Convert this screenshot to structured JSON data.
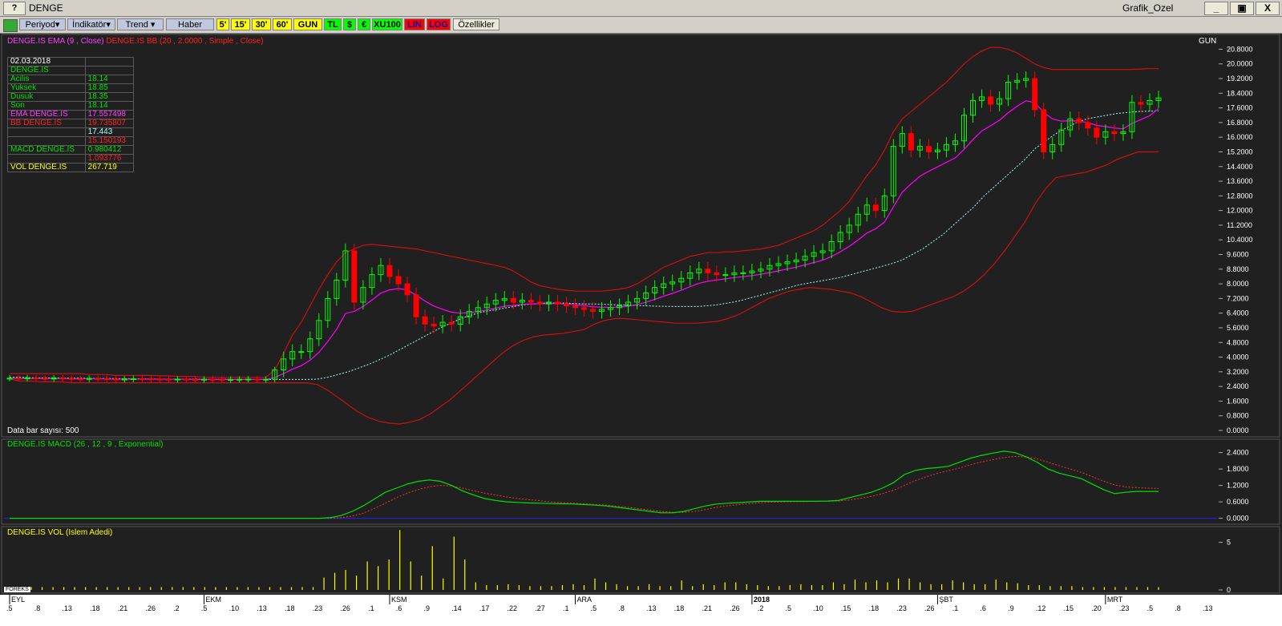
{
  "window": {
    "help": "?",
    "title": "DENGE",
    "right_title": "Grafik_Ozel",
    "min": "_",
    "restore": "▣",
    "close": "X"
  },
  "toolbar": {
    "periyod": "Periyod▾",
    "indikator": "İndikatör▾",
    "trend": "Trend ▾",
    "haber": "Haber",
    "p5": "5'",
    "p15": "15'",
    "p30": "30'",
    "p60": "60'",
    "gun": "GUN",
    "tl": "TL",
    "usd": "$",
    "eur": "€",
    "xu100": "XU100",
    "lin": "LIN",
    "log": "LOG",
    "ozellikler": "Özellikler"
  },
  "price_panel": {
    "legend_ema": "DENGE.IS EMA (9 , Close)",
    "legend_bb": "DENGE.IS BB (20 , 2.0000 , Simple , Close)",
    "period_label": "GUN",
    "bar_count": "Data bar sayısı: 500",
    "colors": {
      "up": "#00ff00",
      "down": "#ff0000",
      "ema": "#ff00ff",
      "bb": "#cc1010",
      "sma": "#a0ffff"
    }
  },
  "info": {
    "date": "02.03.2018",
    "symbol": "DENGE.IS",
    "acilis_label": "Acilis",
    "acilis": "18.14",
    "yuksek_label": "Yuksek",
    "yuksek": "18.85",
    "dusuk_label": "Dusuk",
    "dusuk": "18.35",
    "son_label": "Son",
    "son": "18.14",
    "ema_label": "EMA DENGE.IS",
    "ema": "17.557498",
    "bb_label": "BB DENGE.IS",
    "bb_upper": "19.735807",
    "bb_mid": "17.443",
    "bb_lower": "15.150193",
    "macd_label": "MACD DENGE.IS",
    "macd": "0.980412",
    "macd_signal": "1.093776",
    "vol_label": "VOL DENGE.IS",
    "vol": "267.719"
  },
  "macd_panel": {
    "legend": "DENGE.IS MACD (26 , 12 , 9 , Exponential)"
  },
  "vol_panel": {
    "legend": "DENGE.IS VOL (Islem Adedi)",
    "logo": "FOREKS"
  },
  "chart_data": [
    {
      "type": "line",
      "name": "price",
      "y_ticks": [
        "20.8000",
        "20.0000",
        "19.2000",
        "18.4000",
        "17.6000",
        "16.8000",
        "16.0000",
        "15.2000",
        "14.4000",
        "13.6000",
        "12.8000",
        "12.0000",
        "11.2000",
        "10.4000",
        "9.6000",
        "8.8000",
        "8.0000",
        "7.2000",
        "6.4000",
        "5.6000",
        "4.8000",
        "4.0000",
        "3.2000",
        "2.4000",
        "1.6000",
        "0.8000",
        "0.0000"
      ],
      "ylim": [
        0,
        21.3
      ],
      "closes": [
        2.85,
        2.83,
        2.86,
        2.84,
        2.82,
        2.85,
        2.83,
        2.81,
        2.8,
        2.83,
        2.82,
        2.8,
        2.78,
        2.8,
        2.82,
        2.81,
        2.8,
        2.79,
        2.78,
        2.8,
        2.78,
        2.77,
        2.79,
        2.78,
        2.77,
        2.78,
        2.79,
        2.8,
        2.78,
        2.79,
        3.3,
        3.9,
        4.3,
        4.3,
        5.0,
        6.0,
        7.2,
        8.2,
        9.8,
        7.0,
        7.8,
        8.5,
        9.0,
        8.4,
        8.0,
        7.4,
        6.2,
        5.8,
        5.7,
        5.9,
        5.8,
        6.2,
        6.5,
        6.7,
        6.9,
        7.1,
        7.2,
        7.0,
        7.1,
        7.0,
        6.9,
        7.0,
        6.9,
        6.8,
        6.7,
        6.6,
        6.5,
        6.6,
        6.7,
        6.8,
        7.0,
        7.2,
        7.5,
        7.8,
        8.0,
        8.1,
        8.3,
        8.6,
        8.8,
        8.6,
        8.5,
        8.5,
        8.6,
        8.6,
        8.7,
        8.8,
        9.0,
        9.1,
        9.2,
        9.3,
        9.5,
        9.7,
        9.8,
        10.3,
        10.8,
        11.2,
        11.8,
        12.3,
        12.0,
        12.8,
        15.5,
        16.2,
        15.3,
        15.5,
        15.2,
        15.3,
        15.6,
        15.8,
        17.2,
        18.0,
        18.2,
        17.8,
        18.1,
        19.0,
        19.1,
        19.2,
        17.5,
        15.2,
        15.6,
        16.4,
        17.0,
        16.8,
        16.5,
        16.0,
        16.3,
        16.2,
        16.3,
        17.9,
        17.8,
        18.0,
        18.14
      ],
      "ema": [
        2.85,
        2.84,
        2.84,
        2.84,
        2.84,
        2.84,
        2.83,
        2.82,
        2.82,
        2.82,
        2.82,
        2.81,
        2.8,
        2.8,
        2.8,
        2.8,
        2.8,
        2.8,
        2.79,
        2.79,
        2.79,
        2.78,
        2.78,
        2.78,
        2.78,
        2.78,
        2.78,
        2.78,
        2.78,
        2.78,
        2.89,
        3.1,
        3.34,
        3.53,
        3.83,
        4.26,
        4.85,
        5.52,
        6.38,
        6.5,
        6.76,
        7.11,
        7.49,
        7.67,
        7.74,
        7.67,
        7.38,
        7.06,
        6.79,
        6.61,
        6.45,
        6.4,
        6.42,
        6.48,
        6.57,
        6.68,
        6.78,
        6.82,
        6.88,
        6.9,
        6.9,
        6.92,
        6.92,
        6.9,
        6.86,
        6.81,
        6.75,
        6.72,
        6.71,
        6.73,
        6.78,
        6.87,
        6.99,
        7.15,
        7.32,
        7.48,
        7.65,
        7.84,
        8.03,
        8.14,
        8.21,
        8.27,
        8.34,
        8.39,
        8.45,
        8.52,
        8.61,
        8.71,
        8.81,
        8.91,
        9.03,
        9.16,
        9.29,
        9.49,
        9.75,
        10.04,
        10.39,
        10.77,
        11.01,
        11.37,
        12.2,
        13.0,
        13.46,
        13.87,
        14.14,
        14.38,
        14.63,
        14.87,
        15.34,
        15.87,
        16.34,
        16.63,
        16.92,
        17.34,
        17.69,
        17.99,
        17.89,
        17.35,
        17.0,
        16.88,
        16.9,
        16.88,
        16.8,
        16.64,
        16.58,
        16.5,
        16.46,
        16.75,
        16.96,
        17.17,
        17.56
      ],
      "bb_upper": [
        3.1,
        3.1,
        3.1,
        3.1,
        3.1,
        3.1,
        3.1,
        3.1,
        3.1,
        3.05,
        3.05,
        3.05,
        3.0,
        3.0,
        3.0,
        3.0,
        3.0,
        2.98,
        2.98,
        2.95,
        2.95,
        2.95,
        2.9,
        2.9,
        2.9,
        2.9,
        2.9,
        2.9,
        2.9,
        2.9,
        3.3,
        4.2,
        5.2,
        5.9,
        6.8,
        7.7,
        8.5,
        9.2,
        9.7,
        9.9,
        10.1,
        10.15,
        10.1,
        10.05,
        10.0,
        9.95,
        9.9,
        9.8,
        9.7,
        9.6,
        9.5,
        9.4,
        9.3,
        9.2,
        9.1,
        9.0,
        8.9,
        8.7,
        8.4,
        8.1,
        7.9,
        7.8,
        7.7,
        7.65,
        7.6,
        7.6,
        7.6,
        7.6,
        7.65,
        7.7,
        7.8,
        8.0,
        8.3,
        8.6,
        8.9,
        9.1,
        9.3,
        9.5,
        9.6,
        9.7,
        9.7,
        9.75,
        9.75,
        9.8,
        9.85,
        9.9,
        10.0,
        10.1,
        10.3,
        10.5,
        10.7,
        10.9,
        11.2,
        11.6,
        12.0,
        12.5,
        13.2,
        13.9,
        14.5,
        15.3,
        16.3,
        17.0,
        17.4,
        17.8,
        18.2,
        18.6,
        19.0,
        19.5,
        20.0,
        20.4,
        20.7,
        20.9,
        20.9,
        20.8,
        20.6,
        20.3,
        20.0,
        19.8,
        19.7,
        19.7,
        19.7,
        19.7,
        19.7,
        19.7,
        19.7,
        19.7,
        19.7,
        19.7,
        19.72,
        19.74,
        19.74
      ],
      "bb_lower": [
        2.8,
        2.7,
        2.7,
        2.65,
        2.65,
        2.65,
        2.6,
        2.6,
        2.6,
        2.6,
        2.6,
        2.6,
        2.6,
        2.6,
        2.6,
        2.6,
        2.6,
        2.6,
        2.6,
        2.6,
        2.6,
        2.6,
        2.6,
        2.6,
        2.6,
        2.6,
        2.6,
        2.6,
        2.6,
        2.6,
        2.5,
        2.2,
        1.8,
        1.4,
        1.0,
        0.7,
        0.5,
        0.4,
        0.35,
        0.45,
        0.6,
        0.9,
        1.3,
        1.7,
        2.2,
        2.7,
        3.2,
        3.7,
        4.2,
        4.6,
        4.9,
        5.1,
        5.2,
        5.25,
        5.3,
        5.4,
        5.5,
        5.8,
        6.0,
        6.1,
        6.1,
        6.05,
        6.0,
        5.95,
        5.9,
        5.85,
        5.85,
        5.85,
        5.9,
        5.95,
        6.1,
        6.3,
        6.6,
        6.9,
        7.2,
        7.4,
        7.6,
        7.7,
        7.8,
        7.75,
        7.7,
        7.6,
        7.5,
        7.3,
        7.0,
        6.7,
        6.5,
        6.45,
        6.5,
        6.7,
        6.9,
        7.1,
        7.3,
        7.6,
        8.0,
        8.5,
        9.1,
        9.8,
        10.6,
        11.4,
        12.4,
        13.2,
        13.8,
        13.9,
        14.0,
        14.1,
        14.3,
        14.5,
        14.8,
        15.0,
        15.2,
        15.2,
        15.2
      ],
      "bb_mid": [
        2.9,
        2.9,
        2.88,
        2.87,
        2.87,
        2.86,
        2.85,
        2.85,
        2.84,
        2.83,
        2.83,
        2.82,
        2.82,
        2.81,
        2.81,
        2.8,
        2.8,
        2.8,
        2.8,
        2.79,
        2.79,
        2.79,
        2.78,
        2.78,
        2.78,
        2.78,
        2.78,
        2.78,
        2.78,
        2.78,
        2.8,
        2.9,
        3.05,
        3.2,
        3.4,
        3.6,
        3.85,
        4.1,
        4.4,
        4.7,
        5.0,
        5.3,
        5.6,
        5.85,
        6.1,
        6.3,
        6.45,
        6.55,
        6.65,
        6.75,
        6.85,
        6.9,
        6.95,
        6.95,
        6.95,
        6.93,
        6.9,
        6.9,
        6.88,
        6.86,
        6.84,
        6.82,
        6.8,
        6.78,
        6.77,
        6.76,
        6.76,
        6.76,
        6.8,
        6.86,
        6.95,
        7.05,
        7.2,
        7.35,
        7.5,
        7.65,
        7.8,
        7.95,
        8.05,
        8.15,
        8.25,
        8.35,
        8.5,
        8.65,
        8.8,
        8.95,
        9.1,
        9.3,
        9.6,
        9.9,
        10.3,
        10.7,
        11.2,
        11.7,
        12.2,
        12.8,
        13.3,
        13.8,
        14.3,
        14.8,
        15.4,
        15.8,
        16.2,
        16.5,
        16.8,
        17.0,
        17.1,
        17.2,
        17.3,
        17.35,
        17.4,
        17.42,
        17.44
      ]
    },
    {
      "type": "line",
      "name": "macd",
      "y_ticks": [
        "2.4000",
        "1.8000",
        "1.2000",
        "0.6000",
        "0.0000"
      ],
      "ylim": [
        -0.1,
        2.8
      ],
      "macd": [
        0,
        0,
        0,
        0,
        0,
        0,
        0,
        0,
        0,
        0,
        0,
        0,
        0,
        0,
        0,
        0,
        0,
        0,
        0,
        0,
        0,
        0,
        0,
        0,
        0,
        0,
        0,
        0,
        0,
        0.02,
        0.1,
        0.25,
        0.45,
        0.7,
        0.95,
        1.1,
        1.25,
        1.35,
        1.4,
        1.35,
        1.2,
        1.0,
        0.85,
        0.72,
        0.65,
        0.6,
        0.58,
        0.56,
        0.55,
        0.54,
        0.53,
        0.52,
        0.5,
        0.48,
        0.45,
        0.4,
        0.35,
        0.3,
        0.25,
        0.2,
        0.2,
        0.25,
        0.35,
        0.45,
        0.52,
        0.55,
        0.57,
        0.6,
        0.62,
        0.62,
        0.62,
        0.62,
        0.62,
        0.62,
        0.63,
        0.65,
        0.75,
        0.85,
        0.95,
        1.1,
        1.3,
        1.6,
        1.75,
        1.82,
        1.85,
        1.9,
        2.05,
        2.2,
        2.3,
        2.38,
        2.45,
        2.4,
        2.25,
        2.05,
        1.8,
        1.65,
        1.55,
        1.45,
        1.25,
        1.05,
        0.9,
        0.95,
        0.98,
        0.98,
        0.98
      ],
      "signal": [
        0,
        0,
        0,
        0,
        0,
        0,
        0,
        0,
        0,
        0,
        0,
        0,
        0,
        0,
        0,
        0,
        0,
        0,
        0,
        0,
        0,
        0,
        0,
        0,
        0,
        0,
        0,
        0,
        0,
        0,
        0.02,
        0.08,
        0.18,
        0.35,
        0.55,
        0.75,
        0.92,
        1.05,
        1.15,
        1.2,
        1.18,
        1.1,
        1.0,
        0.92,
        0.85,
        0.78,
        0.72,
        0.68,
        0.64,
        0.6,
        0.57,
        0.55,
        0.53,
        0.5,
        0.48,
        0.44,
        0.4,
        0.35,
        0.3,
        0.25,
        0.22,
        0.22,
        0.25,
        0.32,
        0.4,
        0.46,
        0.5,
        0.54,
        0.57,
        0.59,
        0.6,
        0.61,
        0.61,
        0.62,
        0.62,
        0.63,
        0.67,
        0.73,
        0.8,
        0.9,
        1.02,
        1.2,
        1.38,
        1.52,
        1.64,
        1.74,
        1.84,
        1.96,
        2.06,
        2.14,
        2.22,
        2.26,
        2.24,
        2.17,
        2.05,
        1.92,
        1.8,
        1.68,
        1.52,
        1.36,
        1.22,
        1.15,
        1.12,
        1.1,
        1.09
      ]
    },
    {
      "type": "bar",
      "name": "volume",
      "y_ticks": [
        "5",
        "0"
      ],
      "ylim": [
        0,
        6.4
      ],
      "values": [
        0.3,
        0.3,
        0.3,
        0.3,
        0.3,
        0.3,
        0.3,
        0.3,
        0.3,
        0.3,
        0.3,
        0.3,
        0.3,
        0.3,
        0.3,
        0.3,
        0.3,
        0.3,
        0.3,
        0.3,
        0.3,
        0.3,
        0.3,
        0.3,
        0.3,
        0.3,
        0.3,
        0.3,
        0.3,
        1.3,
        1.8,
        2.1,
        1.5,
        3.0,
        2.5,
        3.2,
        6.3,
        3.0,
        1.5,
        4.6,
        1.2,
        5.6,
        3.2,
        0.8,
        0.5,
        0.5,
        0.6,
        0.5,
        0.4,
        0.4,
        0.4,
        0.5,
        0.6,
        0.5,
        1.2,
        0.8,
        0.6,
        0.4,
        0.4,
        0.6,
        0.4,
        0.4,
        1.0,
        0.4,
        0.6,
        0.5,
        0.8,
        0.8,
        0.6,
        0.5,
        0.4,
        0.4,
        0.5,
        0.6,
        0.5,
        0.5,
        0.8,
        0.6,
        1.1,
        0.8,
        1.0,
        0.8,
        1.2,
        1.2,
        0.8,
        0.6,
        0.6,
        1.0,
        0.8,
        0.6,
        0.6,
        1.1,
        0.8,
        0.7,
        0.5,
        0.5,
        0.4,
        0.4,
        0.4,
        0.3,
        0.3,
        0.3,
        0.3,
        0.3,
        0.3,
        0.3,
        0.3
      ],
      "bar_color": "#ffff00"
    }
  ],
  "x_axis": {
    "months": [
      {
        "label": "EYL",
        "i": 0
      },
      {
        "label": "EKM",
        "i": 22
      },
      {
        "label": "KSM",
        "i": 43
      },
      {
        "label": "ARA",
        "i": 64
      },
      {
        "label": "2018",
        "i": 84
      },
      {
        "label": "ŞBT",
        "i": 105
      },
      {
        "label": "MRT",
        "i": 124
      }
    ],
    "days": [
      ".5",
      ".8",
      ".13",
      ".18",
      ".21",
      ".26",
      ".2",
      ".5",
      ".10",
      ".13",
      ".18",
      ".23",
      ".26",
      ".1",
      ".6",
      ".9",
      ".14",
      ".17",
      ".22",
      ".27",
      ".1",
      ".5",
      ".8",
      ".13",
      ".18",
      ".21",
      ".26",
      ".2",
      ".5",
      ".10",
      ".15",
      ".18",
      ".23",
      ".26",
      ".1",
      ".6",
      ".9",
      ".12",
      ".15",
      ".20",
      ".23",
      ".5",
      ".8",
      ".13"
    ]
  }
}
